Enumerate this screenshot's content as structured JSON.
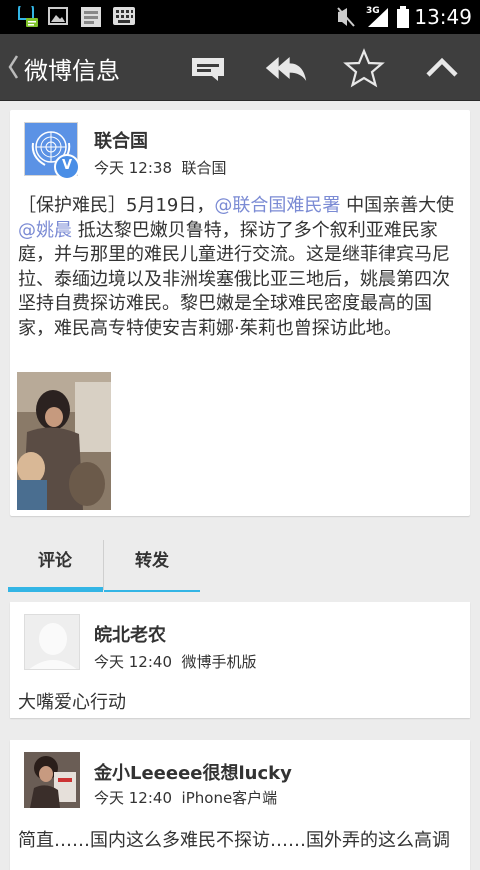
{
  "status_bar": {
    "time": "13:49",
    "network": "3G",
    "icons": [
      "notification-icon",
      "gallery-icon",
      "mail-icon",
      "keyboard-icon",
      "mute-icon",
      "signal-icon",
      "battery-icon"
    ]
  },
  "action_bar": {
    "title": "微博信息",
    "actions": [
      "comment-icon",
      "reply-all-icon",
      "star-icon",
      "collapse-icon"
    ]
  },
  "post": {
    "author": "联合国",
    "time": "今天 12:38",
    "source": "联合国",
    "text_parts": [
      "［保护难民］5月19日，",
      "@联合国难民署",
      " 中国亲善大使",
      "@姚晨",
      " 抵达黎巴嫩贝鲁特，探访了多个叙利亚难民家庭，并与那里的难民儿童进行交流。这是继菲律宾马尼拉、泰缅边境以及非洲埃塞俄比亚三地后，姚晨第四次坚持自费探访难民。黎巴嫩是全球难民密度最高的国家，难民高专特使安吉莉娜·茱莉也曾探访此地。"
    ]
  },
  "tabs": {
    "comments": "评论",
    "reposts": "转发"
  },
  "comments": [
    {
      "author": "皖北老农",
      "time": "今天 12:40",
      "source": "微博手机版",
      "text": "大嘴爱心行动"
    },
    {
      "author": "金小Leeeee很想lucky",
      "time": "今天 12:40",
      "source": "iPhone客户端",
      "text": "简直……国内这么多难民不探访……国外弄的这么高调"
    }
  ],
  "colors": {
    "action_bar": "#3e3e3e",
    "mention": "#7b8bd4",
    "tab_active": "#33b5e5",
    "background": "#ececec"
  }
}
